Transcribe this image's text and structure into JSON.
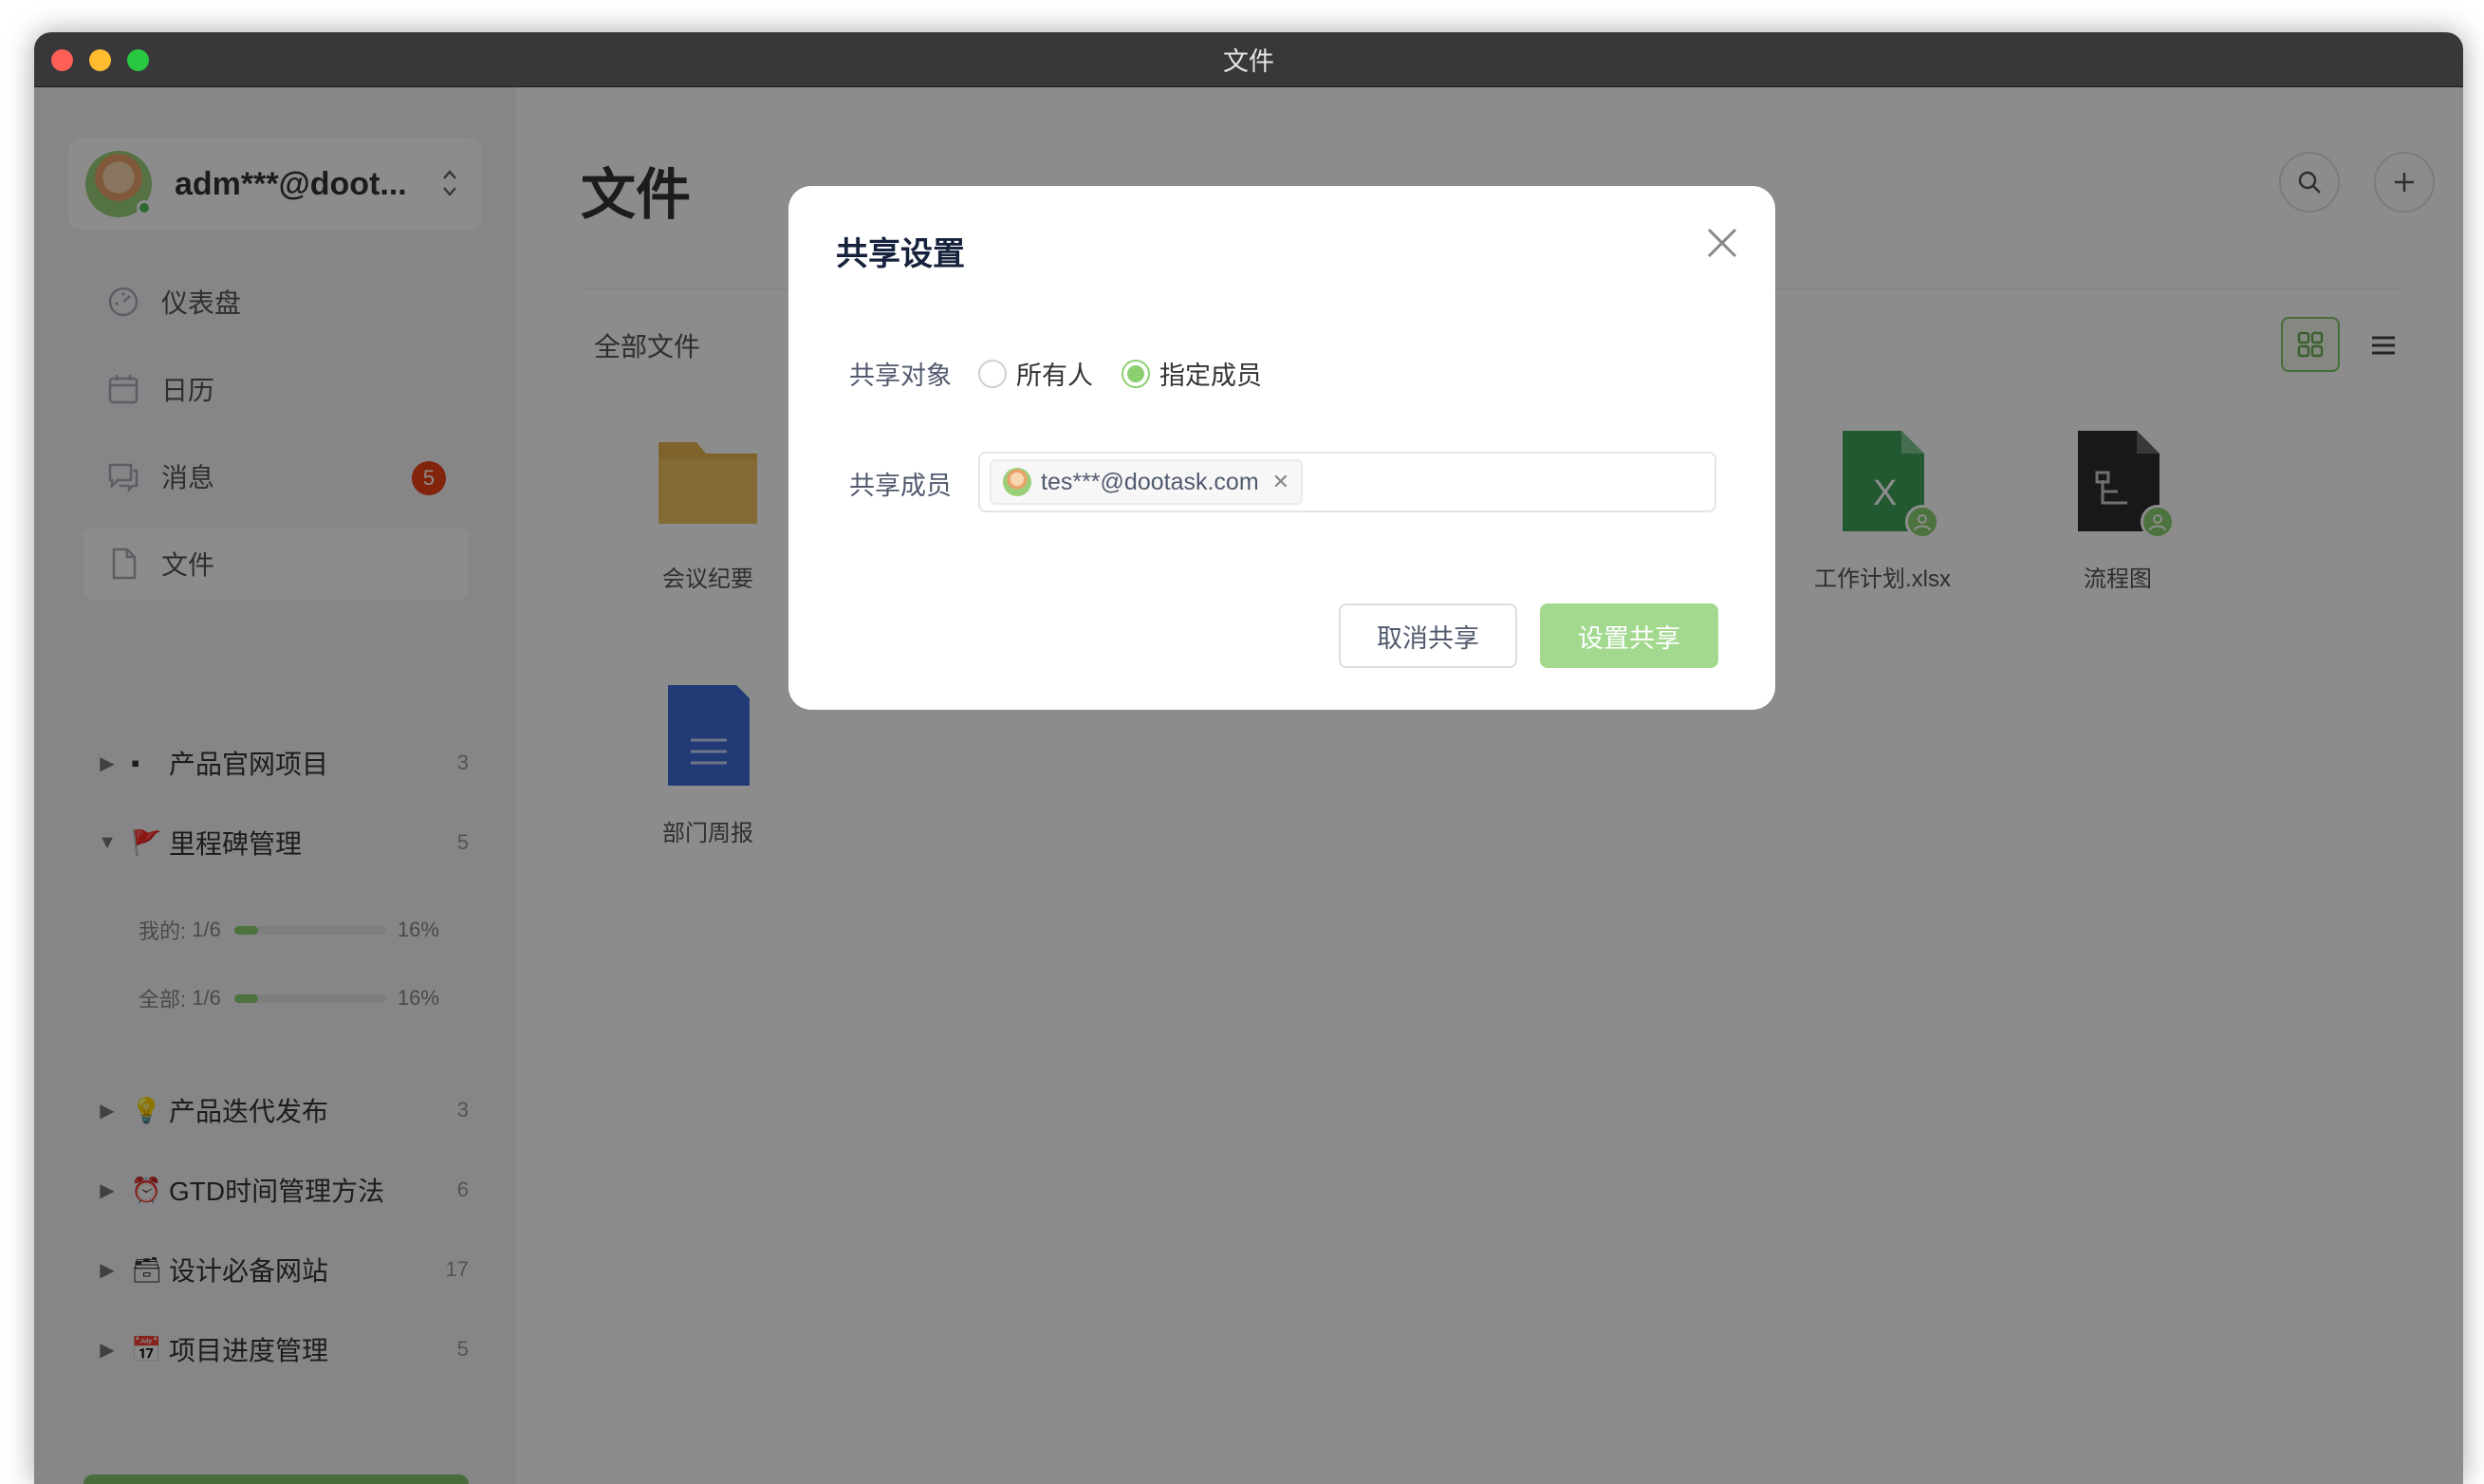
{
  "window": {
    "title": "文件"
  },
  "user": {
    "name": "adm***@doot..."
  },
  "nav": [
    {
      "label": "仪表盘",
      "icon": "dashboard-icon"
    },
    {
      "label": "日历",
      "icon": "calendar-icon"
    },
    {
      "label": "消息",
      "icon": "message-icon",
      "badge": "5"
    },
    {
      "label": "文件",
      "icon": "file-icon",
      "active": true
    }
  ],
  "projects": [
    {
      "name": "产品官网项目",
      "emoji": "▪",
      "count": "3"
    },
    {
      "name": "里程碑管理",
      "emoji": "🚩",
      "count": "5",
      "expanded": true
    },
    {
      "name": "产品迭代发布",
      "emoji": "💡",
      "count": "3"
    },
    {
      "name": "GTD时间管理方法",
      "emoji": "⏰",
      "count": "6"
    },
    {
      "name": "设计必备网站",
      "emoji": "🗃",
      "count": "17"
    },
    {
      "name": "项目进度管理",
      "emoji": "📅",
      "count": "5"
    }
  ],
  "progress": {
    "mine": {
      "label": "我的:",
      "ratio": "1/6",
      "percent": "16%",
      "value": 16
    },
    "all": {
      "label": "全部:",
      "ratio": "1/6",
      "percent": "16%",
      "value": 16
    }
  },
  "main": {
    "title": "文件",
    "breadcrumb": "全部文件",
    "files": [
      {
        "name": "会议纪要",
        "type": "folder"
      },
      {
        "name": "工作计划.xlsx",
        "type": "excel"
      },
      {
        "name": "流程图",
        "type": "flow"
      },
      {
        "name": "部门周报",
        "type": "word"
      }
    ]
  },
  "colors": {
    "accent": "#8bcf70",
    "badge": "#ed4014",
    "folder": "#e6b651",
    "excel": "#3fa25a",
    "word": "#3f6bd8",
    "flow": "#2c2c2c"
  },
  "modal": {
    "title": "共享设置",
    "share_target_label": "共享对象",
    "options": {
      "everyone": "所有人",
      "specific": "指定成员"
    },
    "members_label": "共享成员",
    "member_tag": "tes***@dootask.com",
    "cancel_label": "取消共享",
    "confirm_label": "设置共享"
  }
}
